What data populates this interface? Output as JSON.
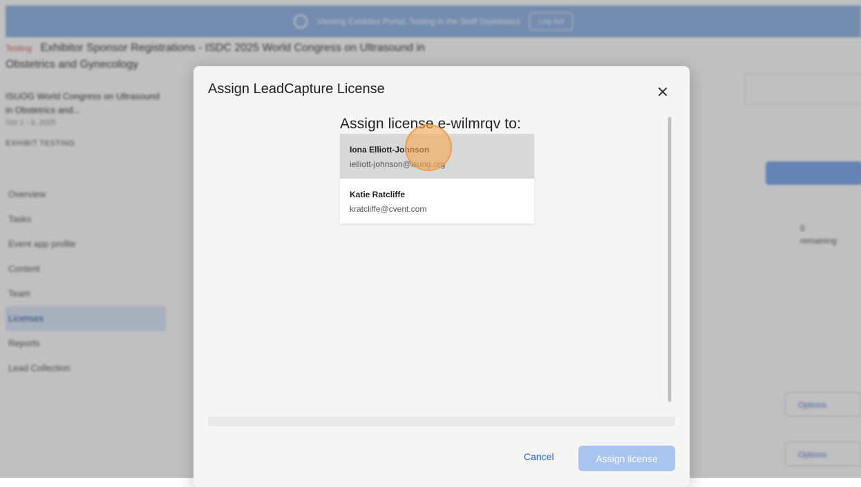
{
  "background": {
    "banner_text": "Viewing Exhibitor Portal. Testing in the Staff Dashboard",
    "banner_button": "Log out",
    "page_title_tag": "Testing",
    "page_title": "Exhibitor Sponsor Registrations - ISDC 2025 World Congress on Ultrasound in Obstetrics and Gynecology",
    "event_name": "ISUOG World Congress on Ultrasound in Obstetrics and...",
    "event_date": "Oct 1 - 3, 2025",
    "event_tag": "EXHIBIT TESTING",
    "nav_items": [
      "Overview",
      "Tasks",
      "Event app profile",
      "Content",
      "Team",
      "Licenses",
      "Reports",
      "Lead Collection"
    ],
    "active_nav": "Licenses",
    "remaining_count": "0",
    "remaining_label": "remaining",
    "option_label": "Options"
  },
  "modal": {
    "title": "Assign LeadCapture License",
    "close_label": "×",
    "heading": "Assign license e-wilmrqv to:",
    "users": [
      {
        "name": "Iona Elliott-Johnson",
        "email": "ielliott-johnson@isuog.org",
        "selected": true
      },
      {
        "name": "Katie Ratcliffe",
        "email": "kratcliffe@cvent.com",
        "selected": false
      }
    ],
    "cancel_label": "Cancel",
    "assign_label": "Assign license"
  }
}
